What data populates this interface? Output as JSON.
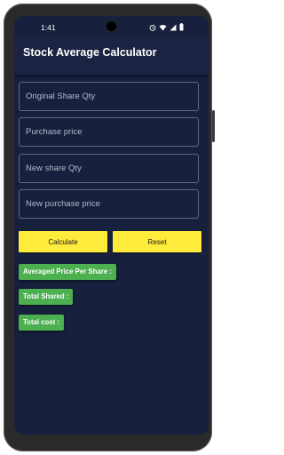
{
  "status_bar": {
    "time": "1:41",
    "icons": [
      "alarm-icon",
      "wifi-icon",
      "signal-icon",
      "battery-icon"
    ]
  },
  "app_bar": {
    "title": "Stock Average Calculator"
  },
  "form": {
    "original_qty_placeholder": "Original Share Qty",
    "purchase_price_placeholder": "Purchase price",
    "new_qty_placeholder": "New share Qty",
    "new_price_placeholder": "New purchase price"
  },
  "actions": {
    "calculate_label": "Calculate",
    "reset_label": "Reset"
  },
  "results": {
    "avg_price_label": "Averaged Price Per Share :",
    "total_shares_label": "Total Shared :",
    "total_cost_label": "Total cost :"
  },
  "colors": {
    "background": "#17213d",
    "button": "#ffeb3b",
    "result_chip": "#4caf50"
  }
}
